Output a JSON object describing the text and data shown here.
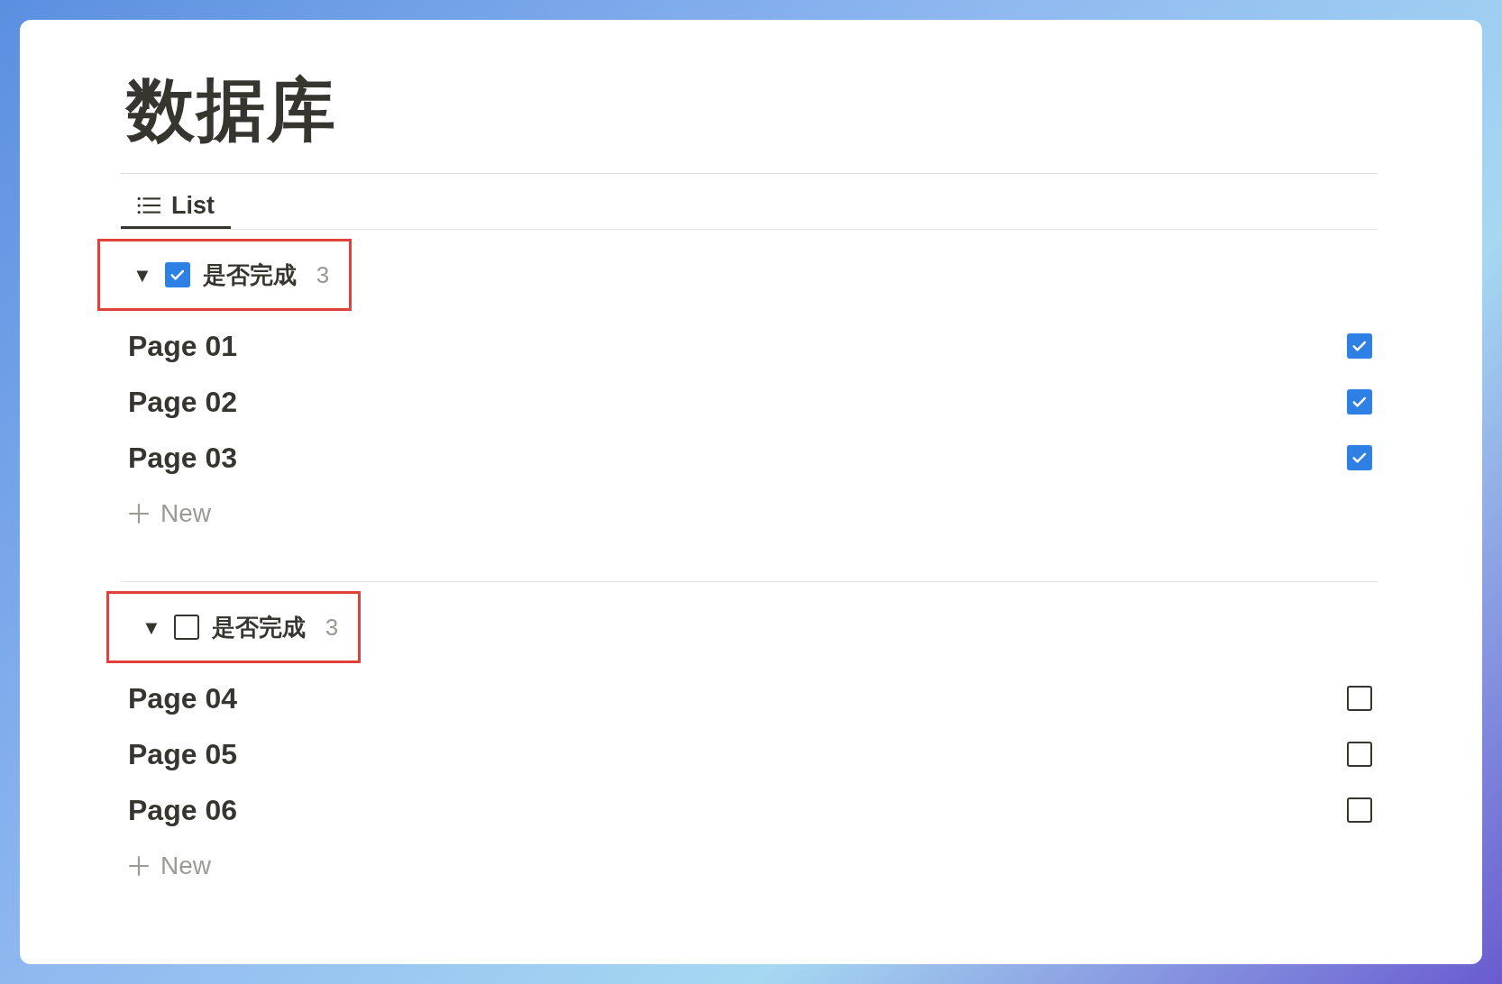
{
  "title": "数据库",
  "tabs": [
    {
      "label": "List",
      "selected": true
    }
  ],
  "groups": [
    {
      "toggle": "▼",
      "checked": true,
      "label": "是否完成",
      "count": "3",
      "expanded": true,
      "rows": [
        {
          "title": "Page 01",
          "checked": true
        },
        {
          "title": "Page 02",
          "checked": true
        },
        {
          "title": "Page 03",
          "checked": true
        }
      ],
      "new_label": "New"
    },
    {
      "toggle": "▼",
      "checked": false,
      "label": "是否完成",
      "count": "3",
      "expanded": true,
      "rows": [
        {
          "title": "Page 04",
          "checked": false
        },
        {
          "title": "Page 05",
          "checked": false
        },
        {
          "title": "Page 06",
          "checked": false
        }
      ],
      "new_label": "New"
    }
  ]
}
